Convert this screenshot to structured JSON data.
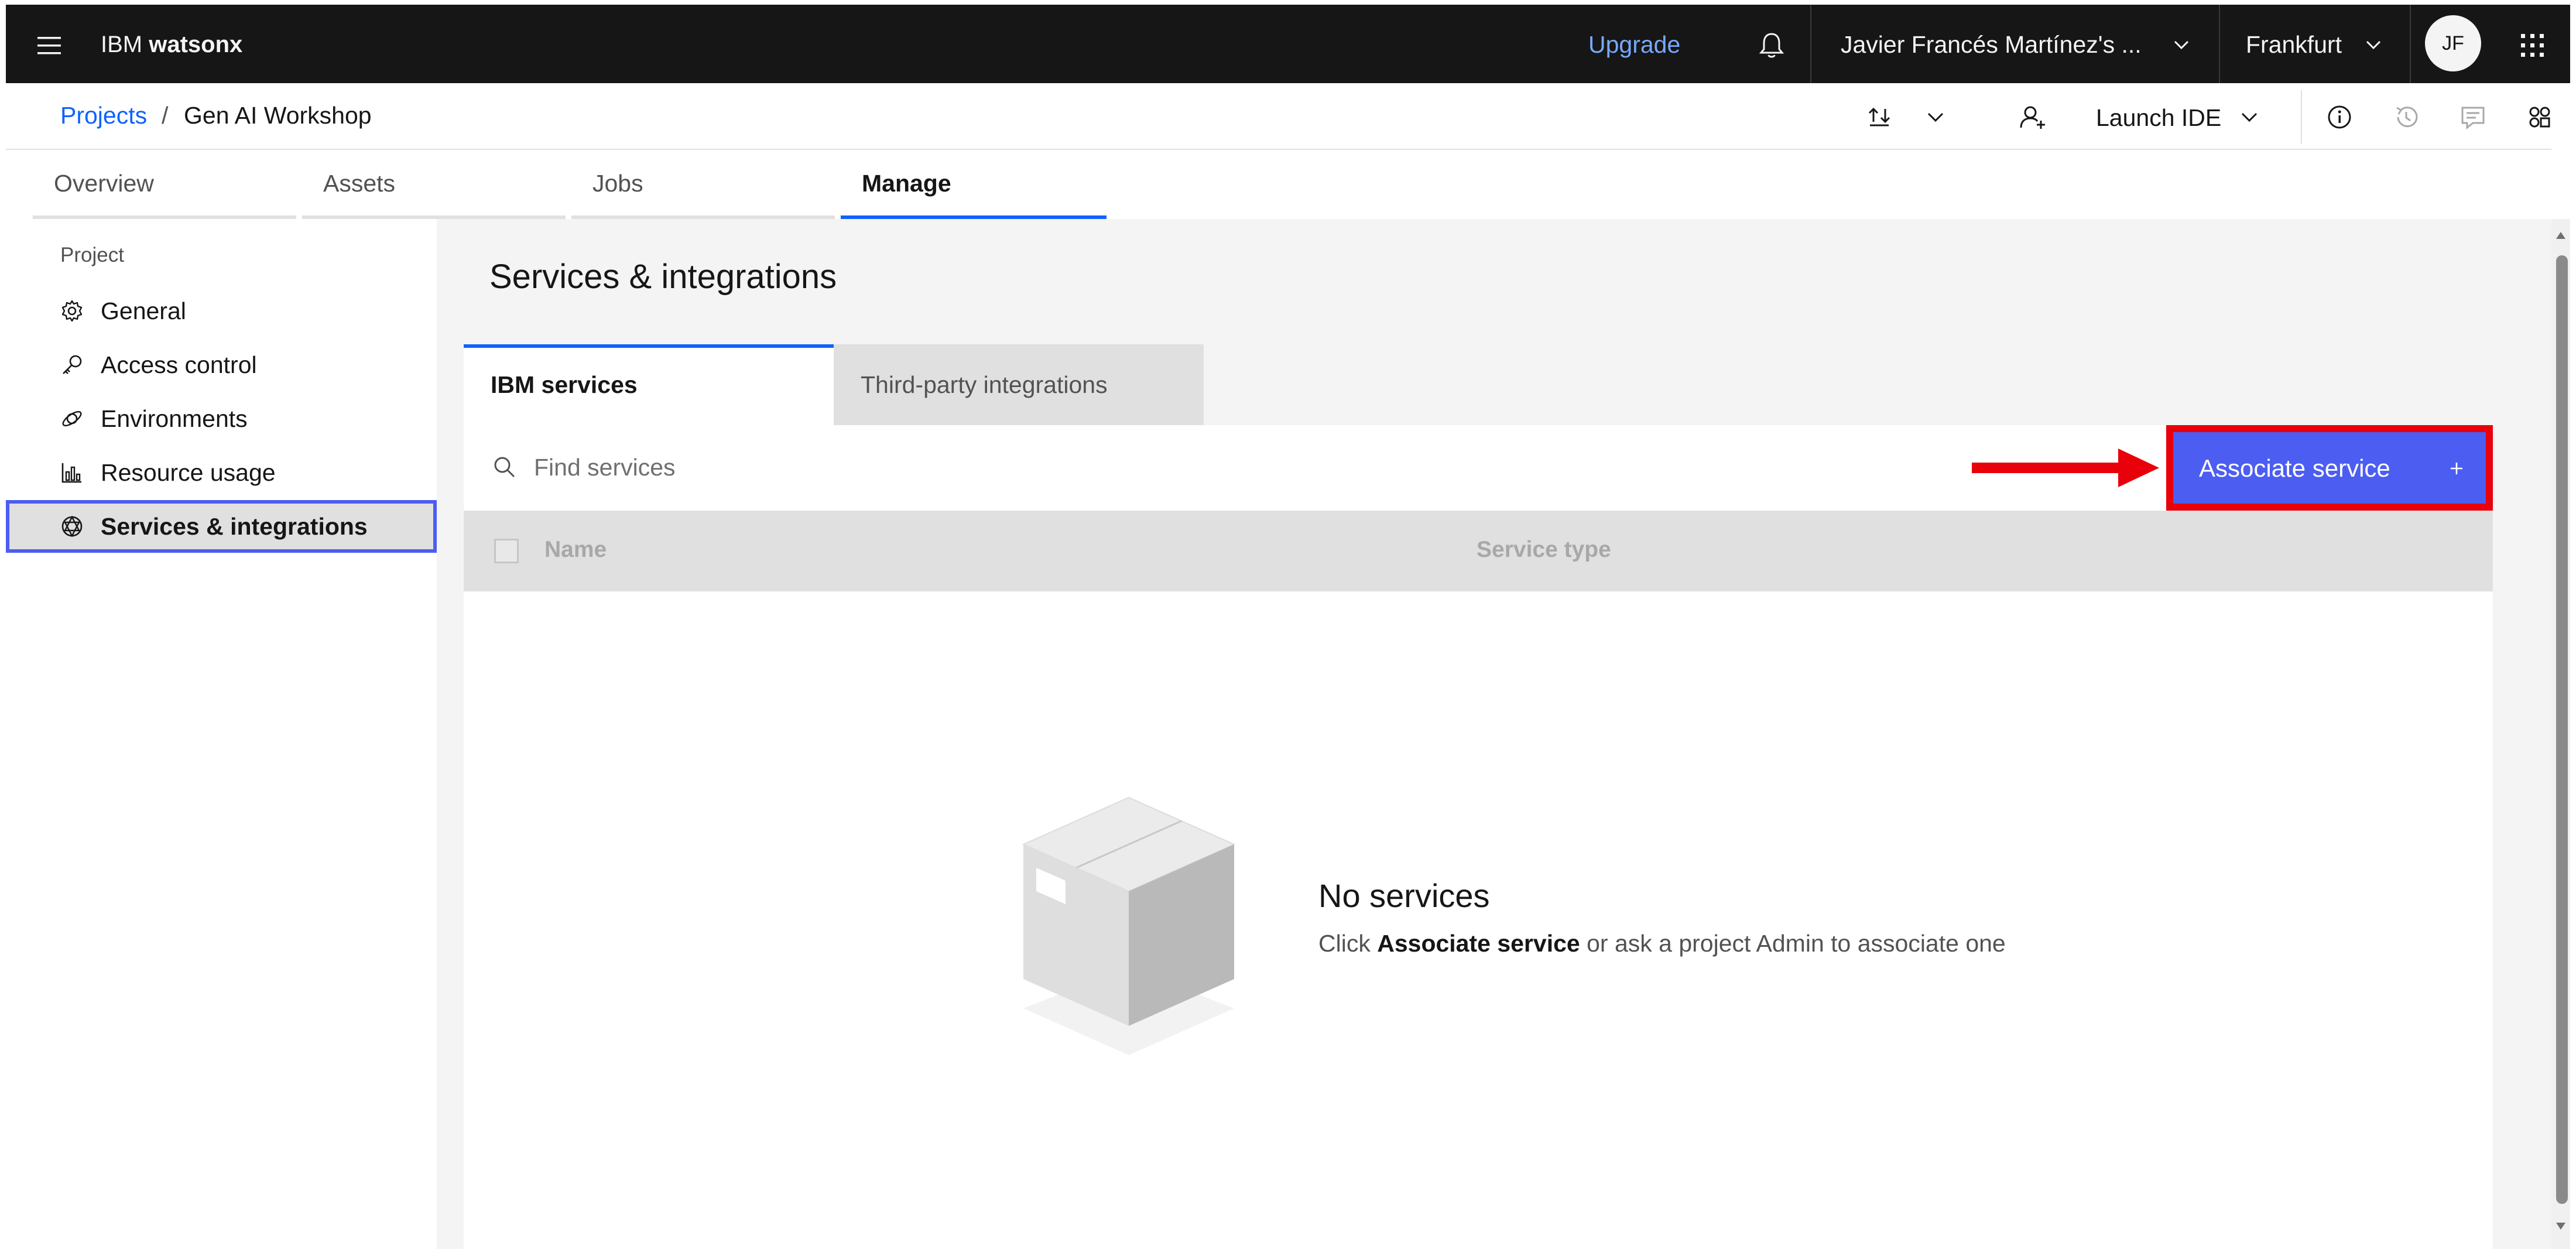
{
  "topbar": {
    "brand_prefix": "IBM",
    "brand_product": "watsonx",
    "upgrade_label": "Upgrade",
    "account_label": "Javier Francés Martínez's ...",
    "region_label": "Frankfurt",
    "avatar_initials": "JF"
  },
  "project_header": {
    "breadcrumb_root": "Projects",
    "breadcrumb_separator": "/",
    "breadcrumb_current": "Gen AI Workshop",
    "launch_ide_label": "Launch IDE"
  },
  "tabs": [
    {
      "label": "Overview",
      "active": false
    },
    {
      "label": "Assets",
      "active": false
    },
    {
      "label": "Jobs",
      "active": false
    },
    {
      "label": "Manage",
      "active": true
    }
  ],
  "sidenav": {
    "heading": "Project",
    "items": [
      {
        "label": "General",
        "icon": "gear-icon",
        "selected": false
      },
      {
        "label": "Access control",
        "icon": "key-icon",
        "selected": false
      },
      {
        "label": "Environments",
        "icon": "environment-icon",
        "selected": false
      },
      {
        "label": "Resource usage",
        "icon": "chart-icon",
        "selected": false
      },
      {
        "label": "Services & integrations",
        "icon": "integration-icon",
        "selected": true
      }
    ]
  },
  "main": {
    "title": "Services & integrations",
    "content_tabs": [
      {
        "label": "IBM services",
        "active": true
      },
      {
        "label": "Third-party integrations",
        "active": false
      }
    ],
    "search_placeholder": "Find services",
    "associate_button_label": "Associate service",
    "table_columns": [
      "Name",
      "Service type"
    ],
    "empty_state": {
      "title": "No services",
      "desc_prefix": "Click",
      "desc_bold": "Associate service",
      "desc_suffix": "or ask a project Admin to associate one"
    }
  },
  "colors": {
    "topbar_bg": "#161616",
    "accent_blue": "#0f62fe",
    "button_bg": "#4c5df2",
    "highlight_red": "#e8000b",
    "upgrade_link": "#78a9ff"
  }
}
